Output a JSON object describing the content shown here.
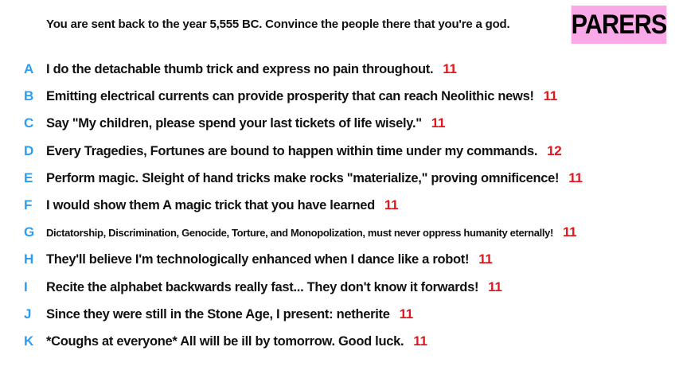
{
  "prompt": "You are sent back to the year 5,555 BC. Convince the people there that you're a god.",
  "logo": "PARERS",
  "colors": {
    "letter": "#2a9df4",
    "score": "#e3161b",
    "logo_background": "#f9a8e8"
  },
  "answers": [
    {
      "letter": "A",
      "text": "I do the detachable thumb trick and express no pain throughout.",
      "score": "11"
    },
    {
      "letter": "B",
      "text": "Emitting electrical currents can provide prosperity that can reach Neolithic news!",
      "score": "11"
    },
    {
      "letter": "C",
      "text": "Say \"My children, please spend your last tickets of life wisely.\"",
      "score": "11"
    },
    {
      "letter": "D",
      "text": "Every Tragedies, Fortunes are bound to happen within time under my commands.",
      "score": "12"
    },
    {
      "letter": "E",
      "text": "Perform magic. Sleight of hand tricks make rocks \"materialize,\" proving omnificence!",
      "score": "11"
    },
    {
      "letter": "F",
      "text": "I would show them A magic trick that you have learned",
      "score": "11"
    },
    {
      "letter": "G",
      "text": "Dictatorship, Discrimination, Genocide, Torture, and Monopolization, must never oppress humanity eternally!",
      "score": "11"
    },
    {
      "letter": "H",
      "text": "They'll believe I'm technologically enhanced when I dance like a robot!",
      "score": "11"
    },
    {
      "letter": "I",
      "text": "Recite the alphabet backwards really fast... They don't know it forwards!",
      "score": "11"
    },
    {
      "letter": "J",
      "text": "Since they were still in the Stone Age, I present: netherite",
      "score": "11"
    },
    {
      "letter": "K",
      "text": "*Coughs at everyone* All will be ill by tomorrow. Good luck.",
      "score": "11"
    }
  ]
}
